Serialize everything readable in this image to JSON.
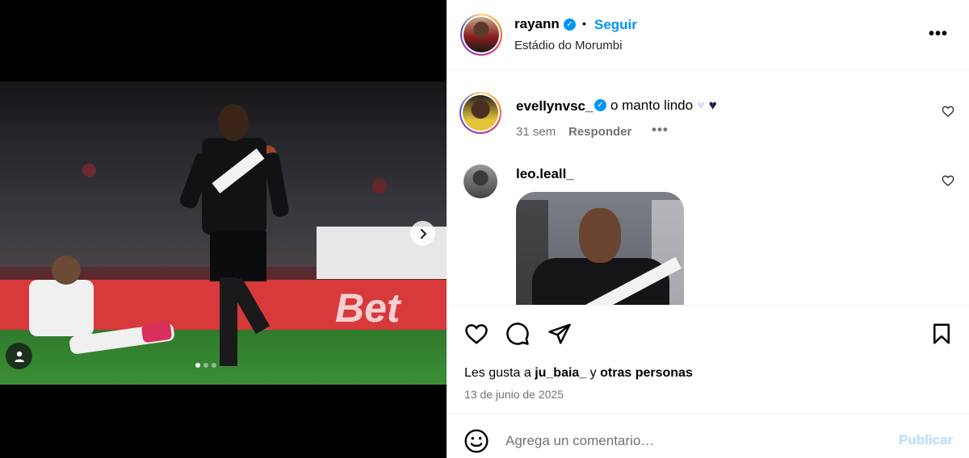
{
  "post": {
    "owner": "rayann",
    "bullet": "•",
    "follow_label": "Seguir",
    "location": "Estádio do Morumbi",
    "more_label": "•••",
    "photo_banner": "Bet",
    "carousel": {
      "total": 3,
      "active": 1
    },
    "next_arrow": "›"
  },
  "comments": [
    {
      "user": "evellynvsc_",
      "text": "o manto lindo",
      "heart_1": "♥",
      "heart_2": "♥",
      "time": "31 sem",
      "reply_label": "Responder",
      "more": "•••"
    },
    {
      "user": "leo.leall_"
    }
  ],
  "actions": {
    "likes_prefix": "Les gusta a",
    "likes_user": "ju_baia_",
    "likes_joiner": "y",
    "likes_others": "otras personas",
    "date": "13 de junio de 2025"
  },
  "composer": {
    "placeholder": "Agrega un comentario…",
    "publish_label": "Publicar"
  },
  "colors": {
    "accent": "#0095f6",
    "muted": "#737373",
    "publish_disabled": "#b3dbff"
  },
  "icons": [
    "verified-icon",
    "more-options-icon",
    "heart-icon",
    "comment-icon",
    "share-icon",
    "bookmark-icon",
    "emoji-icon",
    "chevron-right-icon",
    "user-tag-icon"
  ]
}
